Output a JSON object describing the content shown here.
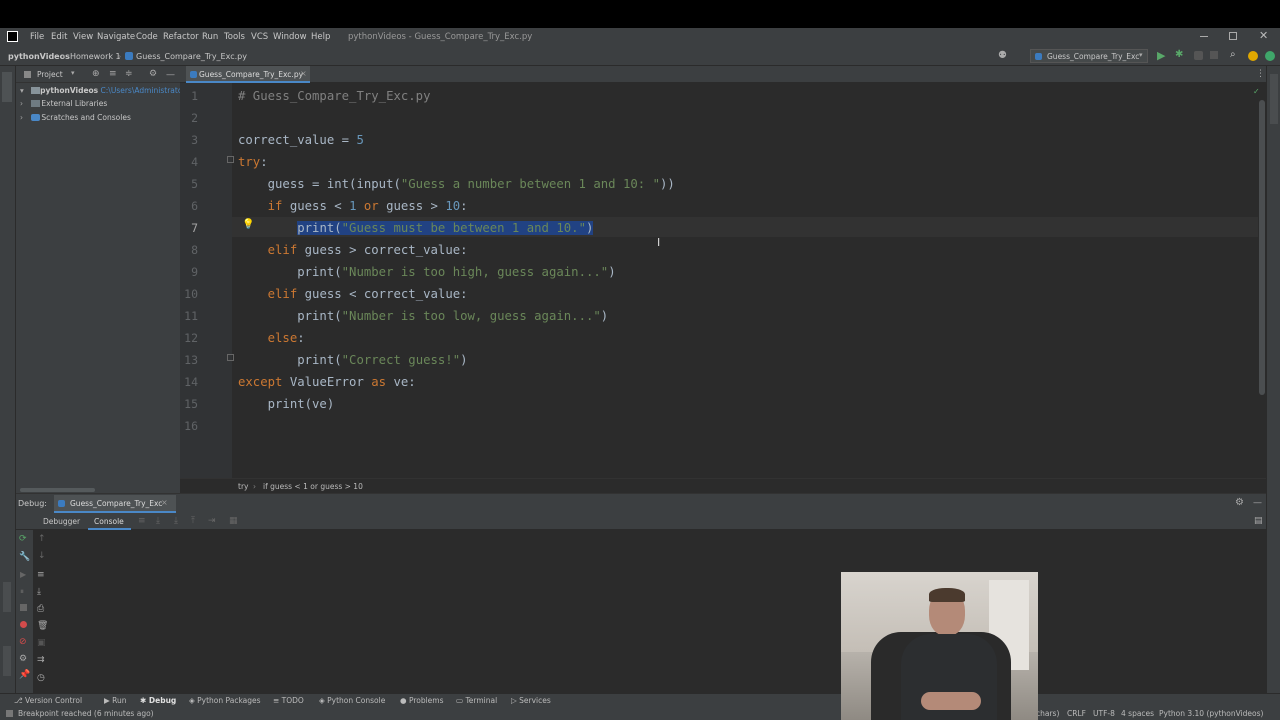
{
  "menu": [
    "File",
    "Edit",
    "View",
    "Navigate",
    "Code",
    "Refactor",
    "Run",
    "Tools",
    "VCS",
    "Window",
    "Help"
  ],
  "window_title": "pythonVideos - Guess_Compare_Try_Exc.py",
  "breadcrumbs": [
    "pythonVideos",
    "Homework 1",
    "Guess_Compare_Try_Exc.py"
  ],
  "run_config": "Guess_Compare_Try_Exc",
  "project_panel": {
    "title": "Project",
    "items": [
      {
        "label": "pythonVideos",
        "path": "C:\\Users\\Administrator"
      },
      {
        "label": "External Libraries"
      },
      {
        "label": "Scratches and Consoles"
      }
    ]
  },
  "editor": {
    "tab": "Guess_Compare_Try_Exc.py",
    "line_numbers": [
      "1",
      "2",
      "3",
      "4",
      "5",
      "6",
      "7",
      "8",
      "9",
      "10",
      "11",
      "12",
      "13",
      "14",
      "15",
      "16"
    ],
    "lines": [
      "# Guess_Compare_Try_Exc.py",
      "",
      "correct_value = 5",
      "try:",
      "    guess = int(input(\"Guess a number between 1 and 10: \"))",
      "    if guess < 1 or guess > 10:",
      "        print(\"Guess must be between 1 and 10.\")",
      "    elif guess > correct_value:",
      "        print(\"Number is too high, guess again...\")",
      "    elif guess < correct_value:",
      "        print(\"Number is too low, guess again...\")",
      "    else:",
      "        print(\"Correct guess!\")",
      "except ValueError as ve:",
      "    print(ve)",
      ""
    ],
    "context_breadcrumb": [
      "try",
      "if guess < 1 or guess > 10"
    ]
  },
  "debug": {
    "label": "Debug:",
    "session_tab": "Guess_Compare_Try_Exc",
    "tabs": [
      "Debugger",
      "Console"
    ]
  },
  "bottom_tool_windows": [
    "Version Control",
    "Run",
    "Debug",
    "Python Packages",
    "TODO",
    "Python Console",
    "Problems",
    "Terminal",
    "Services"
  ],
  "status": {
    "message": "Breakpoint reached (6 minutes ago)",
    "right": [
      "chars)",
      "CRLF",
      "UTF-8",
      "4 spaces",
      "Python 3.10 (pythonVideos)"
    ]
  },
  "colors": {
    "keyword": "#cc7832",
    "string": "#6a8759",
    "number": "#6897bb",
    "comment": "#808080",
    "selection": "#214283"
  }
}
